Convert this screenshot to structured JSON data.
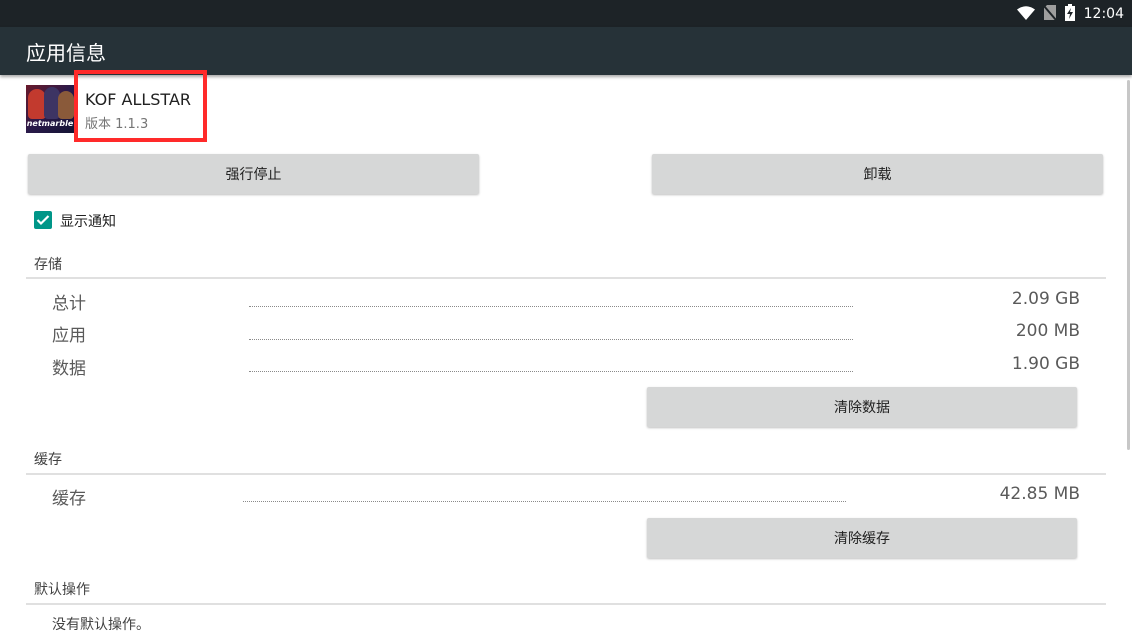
{
  "status_bar": {
    "time": "12:04",
    "icons": [
      "wifi-icon",
      "no-sim-icon",
      "battery-charging-icon"
    ]
  },
  "app_bar": {
    "title": "应用信息"
  },
  "app": {
    "name": "KOF ALLSTAR",
    "version": "版本 1.1.3",
    "icon_text": "netmarble"
  },
  "buttons": {
    "force_stop": "强行停止",
    "uninstall": "卸载",
    "clear_data": "清除数据",
    "clear_cache": "清除缓存"
  },
  "notifications": {
    "label": "显示通知",
    "checked": true
  },
  "storage": {
    "header": "存储",
    "rows": [
      {
        "label": "总计",
        "value": "2.09 GB"
      },
      {
        "label": "应用",
        "value": "200 MB"
      },
      {
        "label": "数据",
        "value": "1.90 GB"
      }
    ]
  },
  "cache": {
    "header": "缓存",
    "rows": [
      {
        "label": "缓存",
        "value": "42.85 MB"
      }
    ]
  },
  "defaults": {
    "header": "默认操作",
    "text": "没有默认操作。"
  },
  "colors": {
    "app_bar": "#263238",
    "status_bar": "#1d2327",
    "accent": "#009688",
    "highlight_box": "#ff2a2a",
    "button_bg": "#d6d7d7"
  }
}
